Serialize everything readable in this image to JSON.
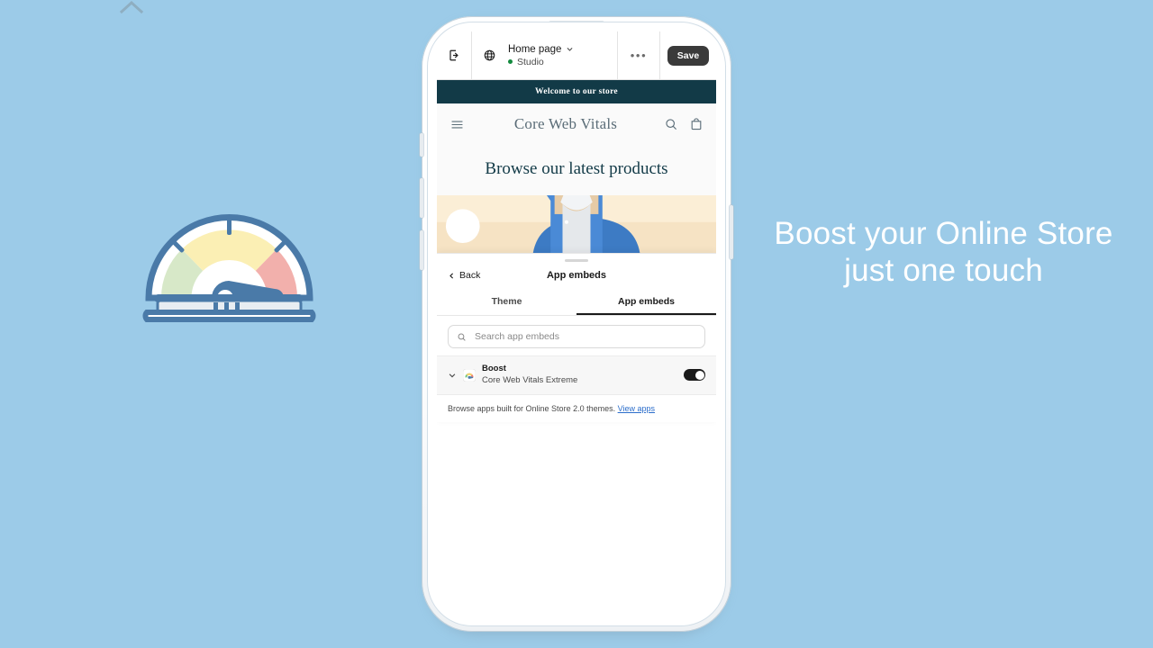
{
  "background_color": "#9ccbe8",
  "corner_mark": {
    "icon": "chevron-up-icon"
  },
  "illustration": {
    "name": "speedometer-gauge-illustration",
    "colors": {
      "frame": "#4a7aa8",
      "green_segment": "#d7e8c8",
      "yellow_segment": "#fbefb4",
      "red_segment": "#f2b0ac",
      "needle": "#4a7aa8",
      "base": "#e8edf2"
    }
  },
  "tagline": {
    "line1": "Boost your Online Store",
    "line2": "just one touch",
    "color": "#ffffff"
  },
  "editor": {
    "exit_icon": "exit-arrow-icon",
    "globe_icon": "globe-icon",
    "page_name": "Home page",
    "page_chevron_icon": "chevron-down-icon",
    "status": "Studio",
    "status_dot_color": "#138a3e",
    "more_label": "•••",
    "save_label": "Save",
    "save_bg": "#3a3a3a"
  },
  "storefront": {
    "announcement": "Welcome to our store",
    "announcement_bg": "#123a47",
    "menu_icon": "hamburger-menu-icon",
    "shop_name": "Core Web Vitals",
    "search_icon": "search-icon",
    "cart_icon": "shopping-bag-icon",
    "hero_title": "Browse our latest products",
    "hero_image_alt": "person-in-blue-jacket-illustration"
  },
  "sheet": {
    "back_label": "Back",
    "back_icon": "chevron-left-icon",
    "title": "App embeds",
    "tabs": [
      {
        "label": "Theme",
        "active": false
      },
      {
        "label": "App embeds",
        "active": true
      }
    ],
    "search": {
      "placeholder": "Search app embeds",
      "value": "",
      "icon": "search-icon"
    },
    "embeds": [
      {
        "expand_icon": "chevron-down-icon",
        "app_icon": "gauge-app-icon",
        "name": "Boost",
        "subtitle": "Core Web Vitals Extreme",
        "enabled": true
      }
    ],
    "footer_text": "Browse apps built for Online Store 2.0 themes.",
    "footer_link": "View apps",
    "footer_link_color": "#2c6ecb"
  }
}
